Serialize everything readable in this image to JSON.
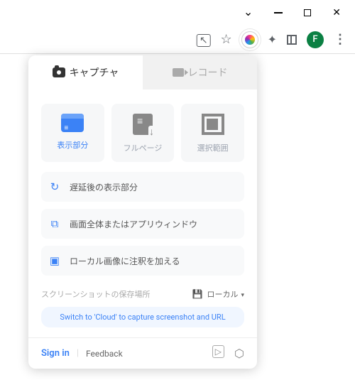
{
  "window": {
    "avatar_letter": "F"
  },
  "tabs": {
    "capture": "キャプチャ",
    "record": "レコード"
  },
  "options": {
    "visible": "表示部分",
    "fullpage": "フルページ",
    "select": "選択範囲"
  },
  "list": {
    "delayed": "遅延後の表示部分",
    "desktop": "画面全体またはアプリウィンドウ",
    "annotate": "ローカル画像に注釈を加える"
  },
  "storage": {
    "label": "スクリーンショットの保存場所",
    "value": "ローカル"
  },
  "cloud_tip": "Switch to 'Cloud' to capture screenshot and URL",
  "footer": {
    "signin": "Sign in",
    "feedback": "Feedback"
  }
}
